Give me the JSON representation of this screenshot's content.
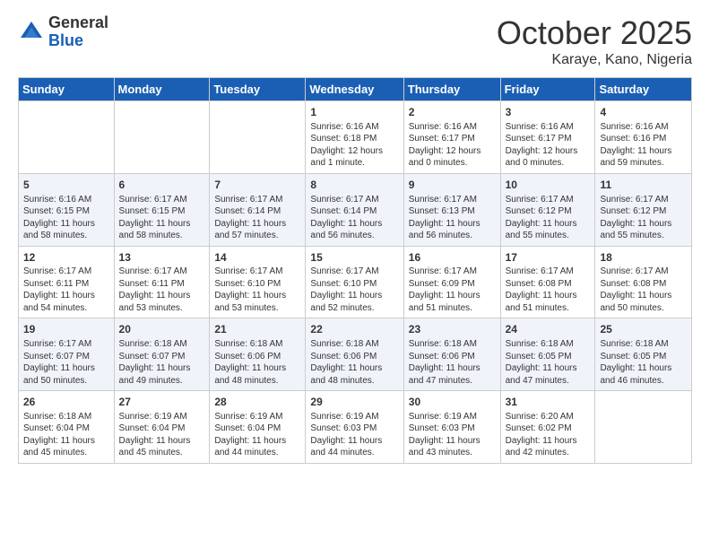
{
  "header": {
    "logo_general": "General",
    "logo_blue": "Blue",
    "month_title": "October 2025",
    "subtitle": "Karaye, Kano, Nigeria"
  },
  "days_of_week": [
    "Sunday",
    "Monday",
    "Tuesday",
    "Wednesday",
    "Thursday",
    "Friday",
    "Saturday"
  ],
  "weeks": [
    [
      {
        "day": "",
        "info": ""
      },
      {
        "day": "",
        "info": ""
      },
      {
        "day": "",
        "info": ""
      },
      {
        "day": "1",
        "info": "Sunrise: 6:16 AM\nSunset: 6:18 PM\nDaylight: 12 hours\nand 1 minute."
      },
      {
        "day": "2",
        "info": "Sunrise: 6:16 AM\nSunset: 6:17 PM\nDaylight: 12 hours\nand 0 minutes."
      },
      {
        "day": "3",
        "info": "Sunrise: 6:16 AM\nSunset: 6:17 PM\nDaylight: 12 hours\nand 0 minutes."
      },
      {
        "day": "4",
        "info": "Sunrise: 6:16 AM\nSunset: 6:16 PM\nDaylight: 11 hours\nand 59 minutes."
      }
    ],
    [
      {
        "day": "5",
        "info": "Sunrise: 6:16 AM\nSunset: 6:15 PM\nDaylight: 11 hours\nand 58 minutes."
      },
      {
        "day": "6",
        "info": "Sunrise: 6:17 AM\nSunset: 6:15 PM\nDaylight: 11 hours\nand 58 minutes."
      },
      {
        "day": "7",
        "info": "Sunrise: 6:17 AM\nSunset: 6:14 PM\nDaylight: 11 hours\nand 57 minutes."
      },
      {
        "day": "8",
        "info": "Sunrise: 6:17 AM\nSunset: 6:14 PM\nDaylight: 11 hours\nand 56 minutes."
      },
      {
        "day": "9",
        "info": "Sunrise: 6:17 AM\nSunset: 6:13 PM\nDaylight: 11 hours\nand 56 minutes."
      },
      {
        "day": "10",
        "info": "Sunrise: 6:17 AM\nSunset: 6:12 PM\nDaylight: 11 hours\nand 55 minutes."
      },
      {
        "day": "11",
        "info": "Sunrise: 6:17 AM\nSunset: 6:12 PM\nDaylight: 11 hours\nand 55 minutes."
      }
    ],
    [
      {
        "day": "12",
        "info": "Sunrise: 6:17 AM\nSunset: 6:11 PM\nDaylight: 11 hours\nand 54 minutes."
      },
      {
        "day": "13",
        "info": "Sunrise: 6:17 AM\nSunset: 6:11 PM\nDaylight: 11 hours\nand 53 minutes."
      },
      {
        "day": "14",
        "info": "Sunrise: 6:17 AM\nSunset: 6:10 PM\nDaylight: 11 hours\nand 53 minutes."
      },
      {
        "day": "15",
        "info": "Sunrise: 6:17 AM\nSunset: 6:10 PM\nDaylight: 11 hours\nand 52 minutes."
      },
      {
        "day": "16",
        "info": "Sunrise: 6:17 AM\nSunset: 6:09 PM\nDaylight: 11 hours\nand 51 minutes."
      },
      {
        "day": "17",
        "info": "Sunrise: 6:17 AM\nSunset: 6:08 PM\nDaylight: 11 hours\nand 51 minutes."
      },
      {
        "day": "18",
        "info": "Sunrise: 6:17 AM\nSunset: 6:08 PM\nDaylight: 11 hours\nand 50 minutes."
      }
    ],
    [
      {
        "day": "19",
        "info": "Sunrise: 6:17 AM\nSunset: 6:07 PM\nDaylight: 11 hours\nand 50 minutes."
      },
      {
        "day": "20",
        "info": "Sunrise: 6:18 AM\nSunset: 6:07 PM\nDaylight: 11 hours\nand 49 minutes."
      },
      {
        "day": "21",
        "info": "Sunrise: 6:18 AM\nSunset: 6:06 PM\nDaylight: 11 hours\nand 48 minutes."
      },
      {
        "day": "22",
        "info": "Sunrise: 6:18 AM\nSunset: 6:06 PM\nDaylight: 11 hours\nand 48 minutes."
      },
      {
        "day": "23",
        "info": "Sunrise: 6:18 AM\nSunset: 6:06 PM\nDaylight: 11 hours\nand 47 minutes."
      },
      {
        "day": "24",
        "info": "Sunrise: 6:18 AM\nSunset: 6:05 PM\nDaylight: 11 hours\nand 47 minutes."
      },
      {
        "day": "25",
        "info": "Sunrise: 6:18 AM\nSunset: 6:05 PM\nDaylight: 11 hours\nand 46 minutes."
      }
    ],
    [
      {
        "day": "26",
        "info": "Sunrise: 6:18 AM\nSunset: 6:04 PM\nDaylight: 11 hours\nand 45 minutes."
      },
      {
        "day": "27",
        "info": "Sunrise: 6:19 AM\nSunset: 6:04 PM\nDaylight: 11 hours\nand 45 minutes."
      },
      {
        "day": "28",
        "info": "Sunrise: 6:19 AM\nSunset: 6:04 PM\nDaylight: 11 hours\nand 44 minutes."
      },
      {
        "day": "29",
        "info": "Sunrise: 6:19 AM\nSunset: 6:03 PM\nDaylight: 11 hours\nand 44 minutes."
      },
      {
        "day": "30",
        "info": "Sunrise: 6:19 AM\nSunset: 6:03 PM\nDaylight: 11 hours\nand 43 minutes."
      },
      {
        "day": "31",
        "info": "Sunrise: 6:20 AM\nSunset: 6:02 PM\nDaylight: 11 hours\nand 42 minutes."
      },
      {
        "day": "",
        "info": ""
      }
    ]
  ]
}
